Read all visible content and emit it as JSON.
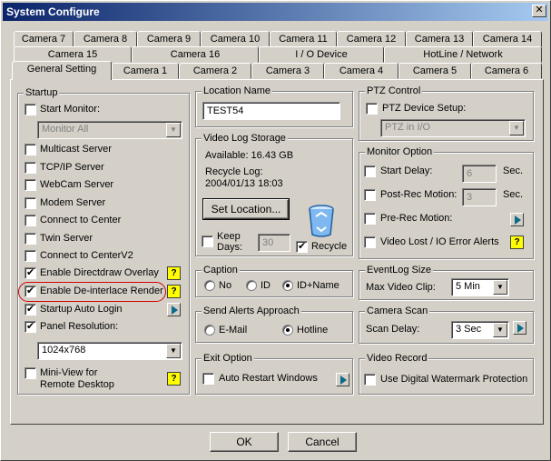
{
  "window": {
    "title": "System Configure",
    "close_glyph": "✕"
  },
  "tabs": {
    "row1": [
      "Camera 7",
      "Camera 8",
      "Camera 9",
      "Camera 10",
      "Camera 11",
      "Camera 12",
      "Camera 13",
      "Camera 14"
    ],
    "row2": [
      "Camera 15",
      "Camera 16",
      "I / O Device",
      "HotLine / Network"
    ],
    "row3": [
      "General Setting",
      "Camera 1",
      "Camera 2",
      "Camera 3",
      "Camera 4",
      "Camera 5",
      "Camera 6"
    ]
  },
  "startup": {
    "title": "Startup",
    "start_monitor": "Start Monitor:",
    "monitor_select": "Monitor All",
    "items": [
      "Multicast Server",
      "TCP/IP Server",
      "WebCam Server",
      "Modem Server",
      "Connect to Center",
      "Twin Server",
      "Connect to CenterV2",
      "Enable Directdraw Overlay",
      "Enable De-interlace Render",
      "Startup Auto Login",
      "Panel Resolution:"
    ],
    "resolution": "1024x768",
    "mini_view": [
      "Mini-View for",
      "Remote Desktop"
    ]
  },
  "location": {
    "title": "Location Name",
    "value": "TEST54"
  },
  "video_log": {
    "title": "Video Log Storage",
    "available": "Available: 16.43 GB",
    "recycle_log": "Recycle Log:",
    "recycle_date": "2004/01/13 18:03",
    "set_location": "Set Location...",
    "keep_days": [
      "Keep",
      "Days:"
    ],
    "keep_value": "30",
    "recycle": "Recycle"
  },
  "caption": {
    "title": "Caption",
    "options": [
      "No",
      "ID",
      "ID+Name"
    ]
  },
  "send_alerts": {
    "title": "Send Alerts Approach",
    "options": [
      "E-Mail",
      "Hotline"
    ]
  },
  "exit_option": {
    "title": "Exit Option",
    "auto_restart": "Auto Restart Windows"
  },
  "ptz": {
    "title": "PTZ Control",
    "device_setup": "PTZ Device Setup:",
    "device_select": "PTZ in I/O"
  },
  "monitor_option": {
    "title": "Monitor Option",
    "start_delay": "Start Delay:",
    "start_delay_value": "6",
    "post_rec": "Post-Rec Motion:",
    "post_rec_value": "3",
    "sec": "Sec.",
    "pre_rec": "Pre-Rec Motion:",
    "video_lost": "Video Lost / IO Error Alerts"
  },
  "eventlog": {
    "title": "EventLog Size",
    "max_clip": "Max Video Clip:",
    "max_clip_value": "5 Min"
  },
  "camera_scan": {
    "title": "Camera Scan",
    "scan_delay": "Scan Delay:",
    "scan_delay_value": "3 Sec"
  },
  "video_record": {
    "title": "Video Record",
    "watermark": "Use Digital Watermark Protection"
  },
  "buttons": {
    "ok": "OK",
    "cancel": "Cancel"
  },
  "glyphs": {
    "help": "?",
    "arrow": "▼"
  },
  "colors": {
    "title_start": "#0a246a",
    "title_end": "#a6caf0",
    "highlight_circle": "#d00000"
  }
}
